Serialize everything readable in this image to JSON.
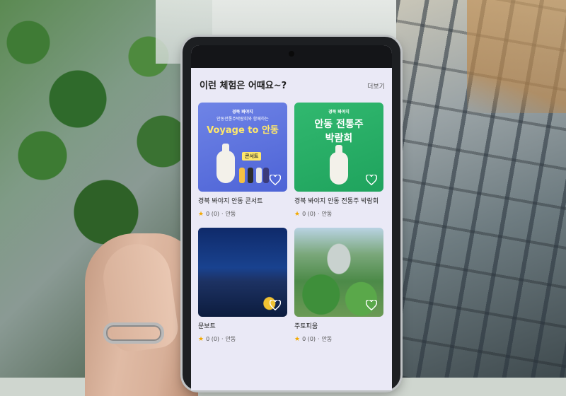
{
  "section": {
    "title": "이런 체험은 어때요~?",
    "more_label": "더보기"
  },
  "cards": [
    {
      "title": "경북 봐야지 안동 콘서트",
      "rating": "0 (0)",
      "separator": "·",
      "location": "안동",
      "poster": {
        "brand": "경북 봐야지",
        "subtitle": "안동전통주박람회와 함께하는",
        "title": "Voyage to 안동",
        "tag": "콘서트"
      }
    },
    {
      "title": "경북 봐야지 안동 전통주 박람회",
      "rating": "0 (0)",
      "separator": "·",
      "location": "안동",
      "poster": {
        "brand": "경북 봐야지",
        "title_line1": "안동 전통주",
        "title_line2": "박람회"
      }
    },
    {
      "title": "문보트",
      "rating": "0 (0)",
      "separator": "·",
      "location": "안동"
    },
    {
      "title": "주토피움",
      "rating": "0 (0)",
      "separator": "·",
      "location": "안동"
    }
  ],
  "colors": {
    "screen_bg": "#eae9f6",
    "voyage_poster": "#5a6fe0",
    "festival_poster": "#28b066",
    "star": "#f2a900"
  }
}
